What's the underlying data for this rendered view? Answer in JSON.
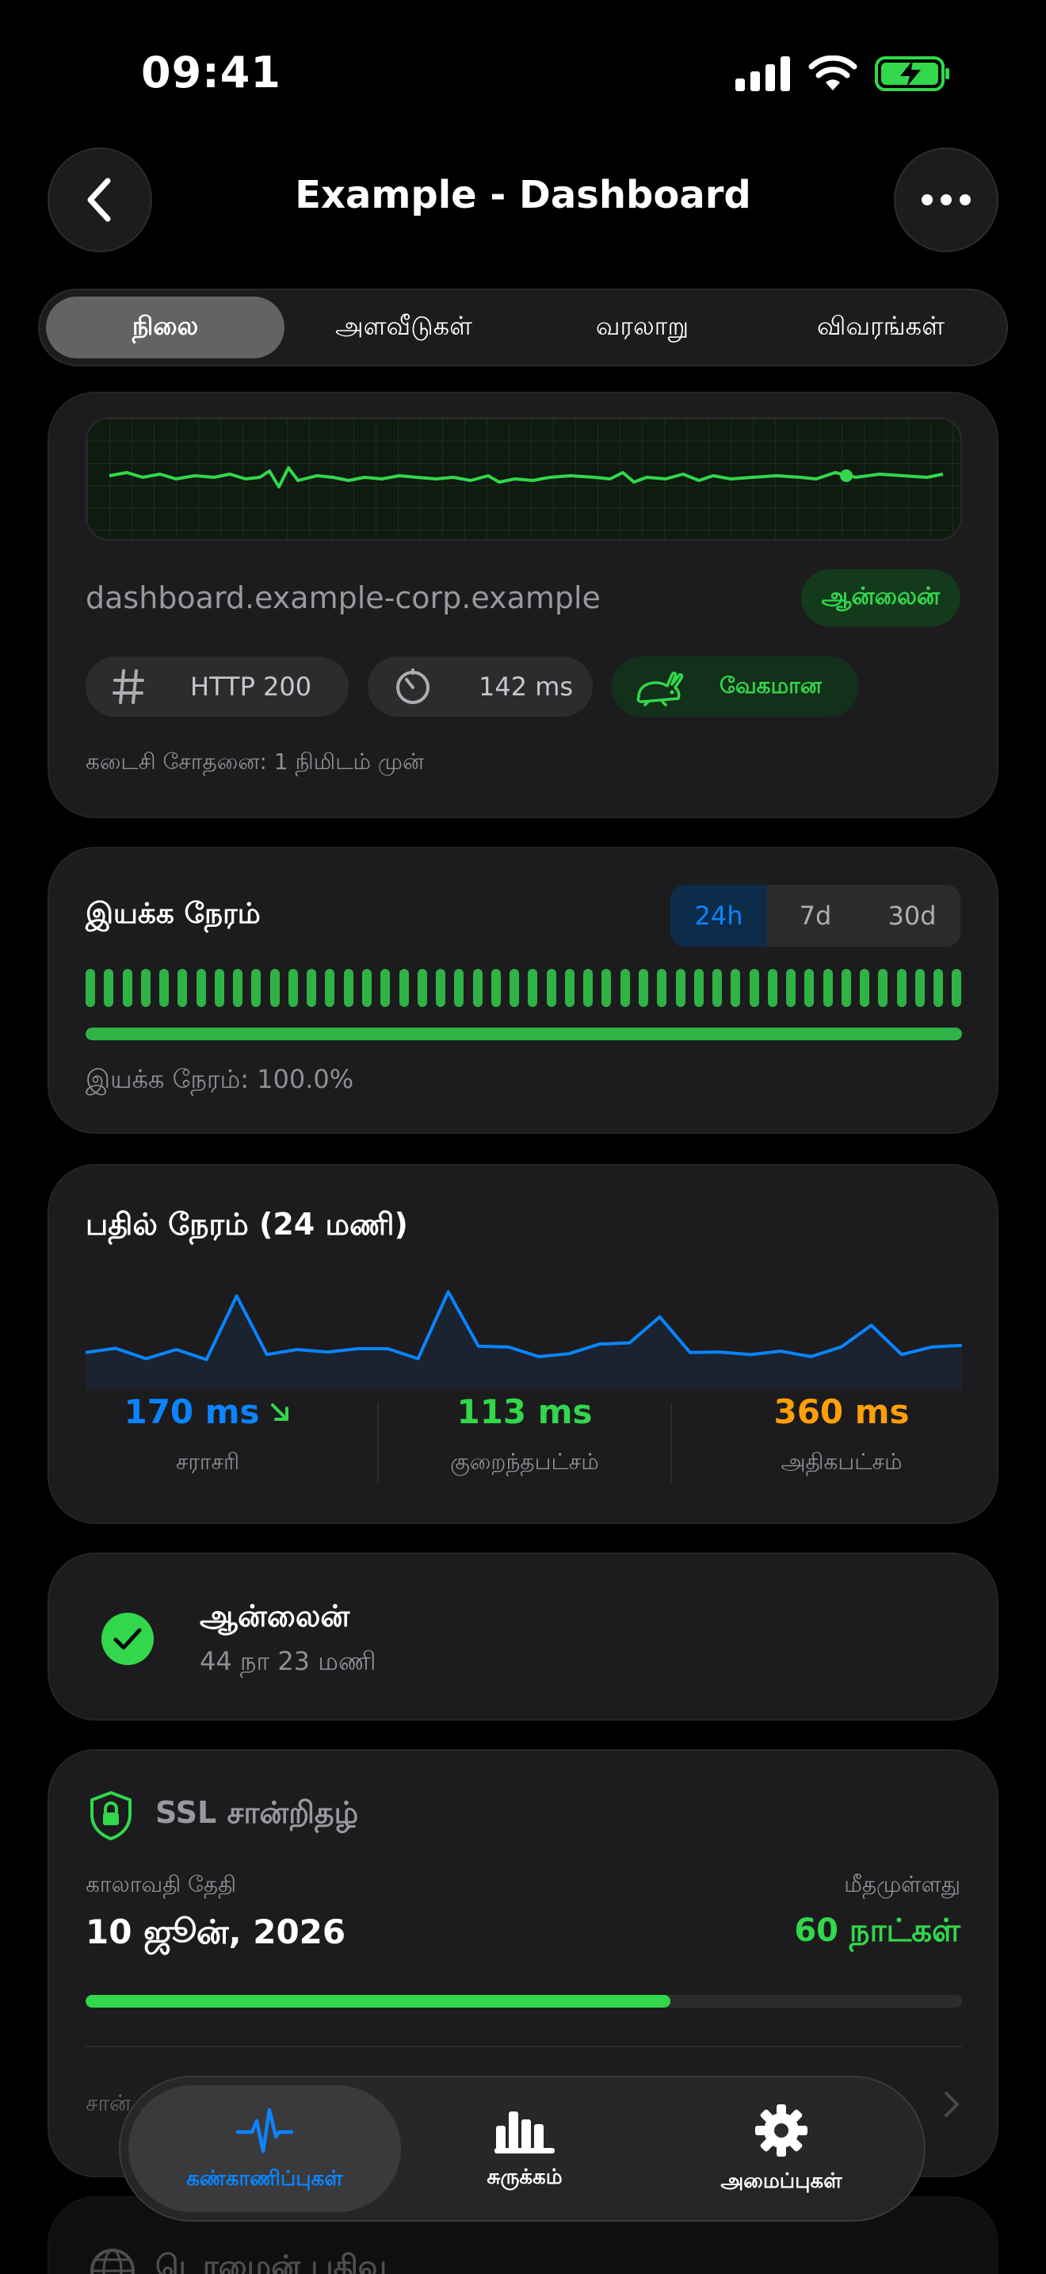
{
  "status": {
    "time": "09:41"
  },
  "header": {
    "title": "Example - Dashboard"
  },
  "tabs": [
    {
      "label": "நிலை",
      "active": true
    },
    {
      "label": "அளவீடுகள்",
      "active": false
    },
    {
      "label": "வரலாறு",
      "active": false
    },
    {
      "label": "விவரங்கள்",
      "active": false
    }
  ],
  "overview": {
    "domain": "dashboard.example-corp.example",
    "status_badge": "ஆன்லைன்",
    "http_code": "HTTP 200",
    "latency": "142 ms",
    "speed_label": "வேகமான",
    "last_check": "கடைசி சோதனை: 1 நிமிடம் முன்"
  },
  "uptime": {
    "title": "இயக்க நேரம்",
    "ranges": [
      "24h",
      "7d",
      "30d"
    ],
    "selected_range": "24h",
    "bar_count": 48,
    "percent_value": 100.0,
    "footer": "இயக்க நேரம்: 100.0%"
  },
  "response": {
    "title": "பதில் நேரம் (24 மணி)",
    "avg": {
      "value": "170 ms",
      "label": "சராசரி"
    },
    "min": {
      "value": "113 ms",
      "label": "குறைந்தபட்சம்"
    },
    "max": {
      "value": "360 ms",
      "label": "அதிகபட்சம்"
    }
  },
  "chart_data": {
    "type": "line",
    "title": "பதில் நேரம் (24 மணி)",
    "series": [
      {
        "values": [
          165,
          175,
          150,
          172,
          148,
          300,
          160,
          172,
          166,
          174,
          174,
          150,
          310,
          180,
          178,
          155,
          162,
          185,
          188,
          250,
          165,
          166,
          160,
          168,
          155,
          178,
          230,
          160,
          178,
          182
        ]
      }
    ],
    "color": "#0a84ff"
  },
  "online_card": {
    "title": "ஆன்லைன்",
    "duration": "44 நா 23 மணி"
  },
  "ssl": {
    "title": "SSL சான்றிதழ்",
    "expiry_label": "காலாவதி தேதி",
    "expiry_date": "10 ஜூன், 2026",
    "remaining_label": "மீதமுள்ளது",
    "remaining_value": "60 நாட்கள்",
    "progress_fraction": 0.667,
    "row_label": "சான்"
  },
  "domain_card": {
    "title": "டொமைன் பதிவு"
  },
  "tabbar": {
    "items": [
      {
        "label": "கண்காணிப்புகள்",
        "active": true
      },
      {
        "label": "சுருக்கம்",
        "active": false
      },
      {
        "label": "அமைப்புகள்",
        "active": false
      }
    ]
  },
  "colors": {
    "accent": "#0a84ff",
    "success": "#32d74b",
    "warning": "#ff9f0a",
    "background": "#000000",
    "card": "#1c1c1e"
  }
}
